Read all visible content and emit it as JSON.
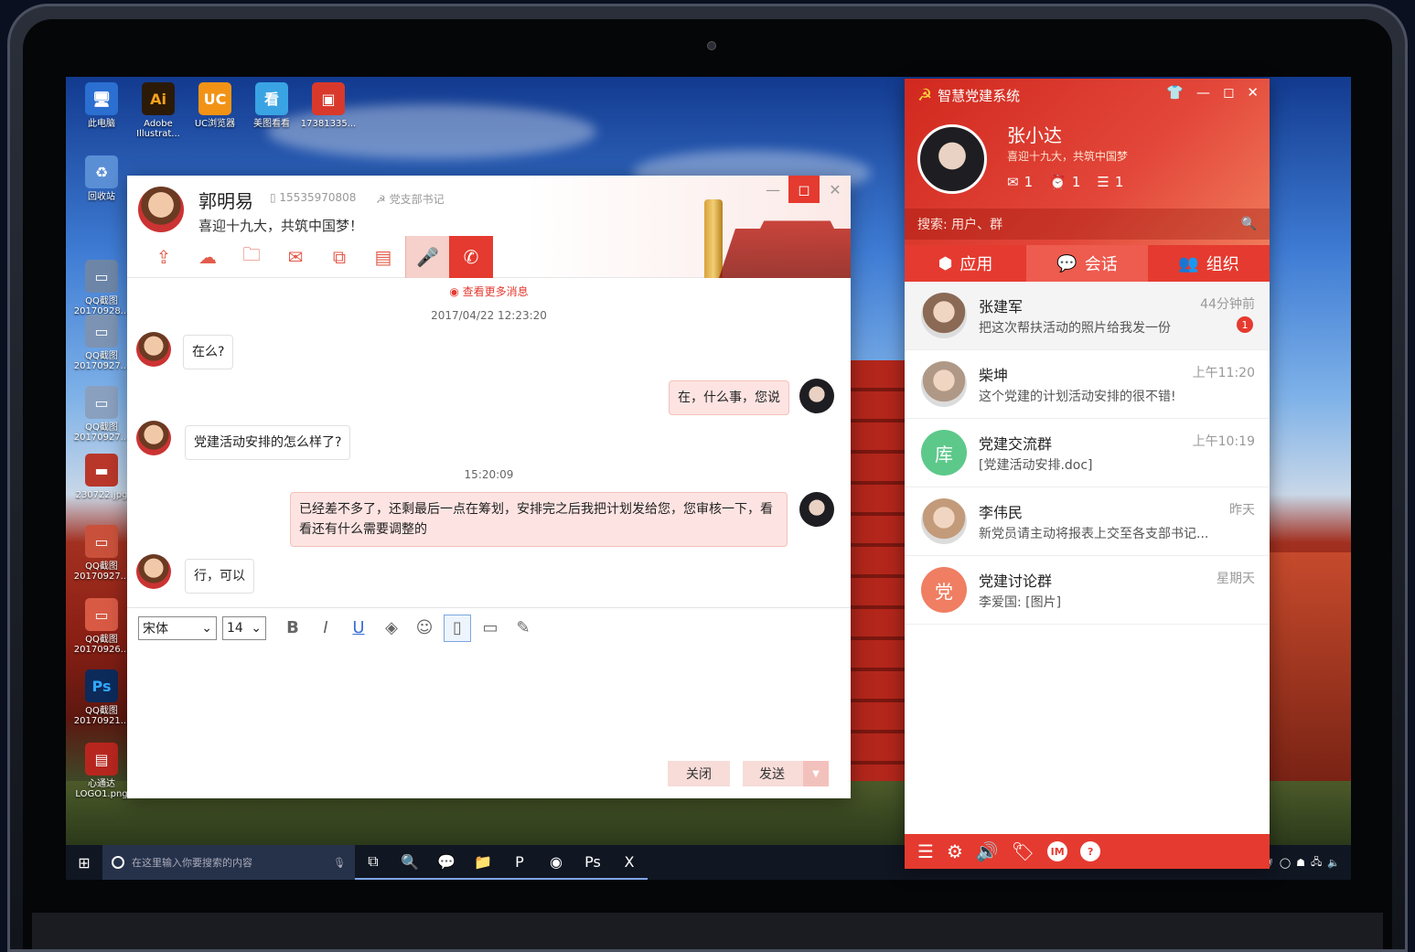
{
  "desktop": {
    "icons": [
      {
        "label": "此电脑",
        "icon": "computer-icon",
        "glyph": "🖥",
        "bg": "#2b6fd1"
      },
      {
        "label": "Adobe Illustrat...",
        "icon": "adobe-illustrator-icon",
        "glyph": "Ai",
        "bg": "#2b1a07",
        "fg": "#f7a21b"
      },
      {
        "label": "UC浏览器",
        "icon": "uc-browser-icon",
        "glyph": "UC",
        "bg": "#f29316"
      },
      {
        "label": "美图看看",
        "icon": "meitu-viewer-icon",
        "glyph": "看",
        "bg": "#3aa3e3"
      },
      {
        "label": "17381335...",
        "icon": "image-file-icon",
        "glyph": "▣",
        "bg": "#d9392b"
      },
      {
        "label": "回收站",
        "icon": "recycle-bin-icon",
        "glyph": "♻",
        "bg": "#5a8fd6"
      },
      {
        "label": "QQ截图 20170928...",
        "icon": "screenshot-icon",
        "glyph": "▭",
        "bg": "#6d86a8"
      },
      {
        "label": "QQ截图 20170927...",
        "icon": "screenshot-icon",
        "glyph": "▭",
        "bg": "#7c93b3"
      },
      {
        "label": "QQ截图 20170927...",
        "icon": "screenshot-icon",
        "glyph": "▭",
        "bg": "#8aa0bf"
      },
      {
        "label": "230722.jpg",
        "icon": "image-file-icon",
        "glyph": "▬",
        "bg": "#b8372a"
      },
      {
        "label": "QQ截图 20170927...",
        "icon": "screenshot-icon",
        "glyph": "▭",
        "bg": "#c9513b"
      },
      {
        "label": "QQ截图 20170926...",
        "icon": "screenshot-icon",
        "glyph": "▭",
        "bg": "#d85a45"
      },
      {
        "label": "QQ截图 20170921...",
        "icon": "photoshop-icon",
        "glyph": "Ps",
        "bg": "#0c2a5a",
        "fg": "#31a8ff"
      },
      {
        "label": "心通达 LOGO1.png",
        "icon": "logo-file-icon",
        "glyph": "▤",
        "bg": "#b7261e"
      }
    ]
  },
  "taskbar": {
    "search_placeholder": "在这里输入你要搜索的内容",
    "apps": [
      {
        "icon": "task-view-icon",
        "glyph": "⧉"
      },
      {
        "icon": "search-app-icon",
        "glyph": "🔍"
      },
      {
        "icon": "wechat-icon",
        "glyph": "💬"
      },
      {
        "icon": "file-explorer-icon",
        "glyph": "📁"
      },
      {
        "icon": "powerpoint-icon",
        "glyph": "P"
      },
      {
        "icon": "chrome-icon",
        "glyph": "◉"
      },
      {
        "icon": "photoshop-icon",
        "glyph": "Ps"
      },
      {
        "icon": "excel-icon",
        "glyph": "X"
      }
    ]
  },
  "chat": {
    "name": "郭明易",
    "phone": "15535970808",
    "role": "党支部书记",
    "motto": "喜迎十九大，共筑中国梦！",
    "more_link": "查看更多消息",
    "timestamp1": "2017/04/22  12:23:20",
    "timestamp2": "15:20:09",
    "messages": [
      {
        "side": "l",
        "text": "在么?"
      },
      {
        "side": "r",
        "text": "在，什么事，您说"
      },
      {
        "side": "l",
        "text": "党建活动安排的怎么样了?"
      },
      {
        "side": "r",
        "text": "已经差不多了，还剩最后一点在筹划，安排完之后我把计划发给您，您审核一下，看看还有什么需要调整的"
      },
      {
        "side": "l",
        "text": "行，可以"
      }
    ],
    "font_family": "宋体",
    "font_size": "14",
    "close_label": "关闭",
    "send_label": "发送"
  },
  "app": {
    "title": "智慧党建系统",
    "user_name": "张小达",
    "user_motto": "喜迎十九大，共筑中国梦",
    "stats": {
      "mail": "1",
      "alarm": "1",
      "list": "1"
    },
    "search_placeholder": "搜索: 用户、群",
    "tabs": {
      "apps": "应用",
      "chat": "会话",
      "org": "组织"
    },
    "conversations": [
      {
        "name": "张建军",
        "preview": "把这次帮扶活动的照片给我发一份",
        "time": "44分钟前",
        "badge": "1",
        "avatar": "photo",
        "color": "#8a6a55"
      },
      {
        "name": "柴坤",
        "preview": "这个党建的计划活动安排的很不错!",
        "time": "上午11:20",
        "avatar": "photo",
        "color": "#b09886"
      },
      {
        "name": "党建交流群",
        "preview": "[党建活动安排.doc]",
        "time": "上午10:19",
        "avatar": "库",
        "color": "#5cc98a"
      },
      {
        "name": "李伟民",
        "preview": "新党员请主动将报表上交至各支部书记...",
        "time": "昨天",
        "avatar": "photo",
        "color": "#c39b7a"
      },
      {
        "name": "党建讨论群",
        "preview": "李爱国: [图片]",
        "time": "星期天",
        "avatar": "党",
        "color": "#f07e62"
      }
    ]
  }
}
